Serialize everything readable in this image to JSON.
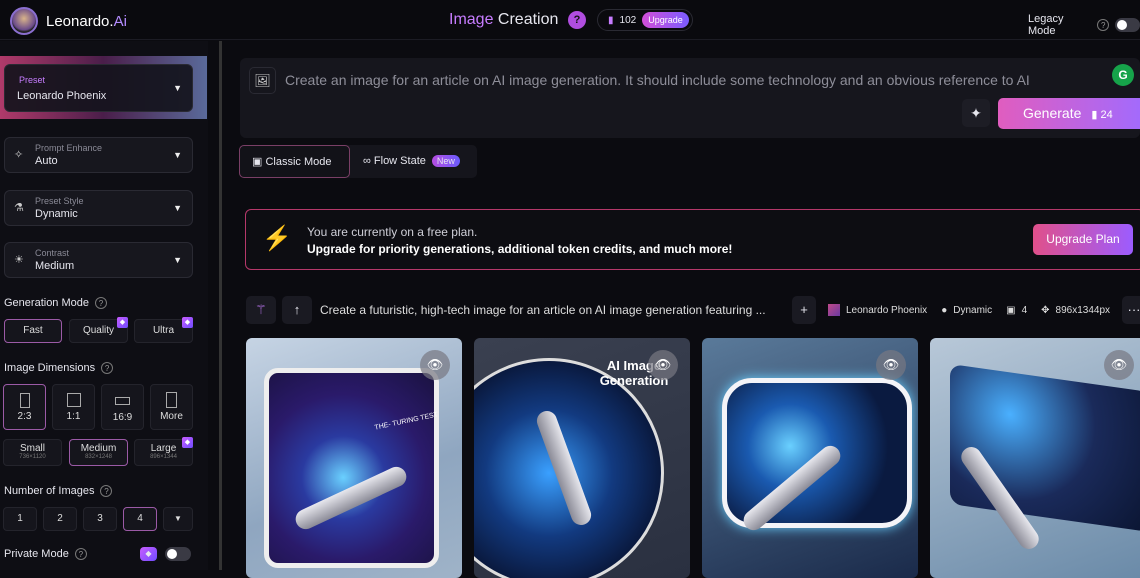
{
  "header": {
    "logo": "Leonardo.",
    "logo_ai": "Ai",
    "title_a": "Image",
    "title_b": "Creation",
    "help": "?",
    "tokens": "102",
    "upgrade": "Upgrade",
    "legacy_mode": "Legacy Mode"
  },
  "sidebar": {
    "preset": {
      "label": "Preset",
      "value": "Leonardo Phoenix"
    },
    "prompt_enhance": {
      "label": "Prompt Enhance",
      "value": "Auto"
    },
    "preset_style": {
      "label": "Preset Style",
      "value": "Dynamic"
    },
    "contrast": {
      "label": "Contrast",
      "value": "Medium"
    },
    "generation_mode": {
      "label": "Generation Mode",
      "options": [
        "Fast",
        "Quality",
        "Ultra"
      ],
      "selected": "Fast"
    },
    "image_dimensions": {
      "label": "Image Dimensions",
      "ratios": [
        "2:3",
        "1:1",
        "16:9",
        "More"
      ],
      "selected_ratio": "2:3",
      "sizes": [
        {
          "name": "Small",
          "dims": "736×1120"
        },
        {
          "name": "Medium",
          "dims": "832×1248"
        },
        {
          "name": "Large",
          "dims": "896×1344"
        }
      ],
      "selected_size": "Medium"
    },
    "number_of_images": {
      "label": "Number of Images",
      "options": [
        "1",
        "2",
        "3",
        "4"
      ],
      "selected": "4"
    },
    "private_mode": {
      "label": "Private Mode",
      "enabled": false
    }
  },
  "prompt": {
    "text": "Create an image for an article on AI image generation. It should include some technology and an obvious reference to AI",
    "generate": "Generate",
    "cost": "24"
  },
  "modes": {
    "classic": "Classic Mode",
    "flow": "Flow State",
    "new": "New"
  },
  "banner": {
    "line1": "You are currently on a free plan.",
    "line2": "Upgrade for priority generations, additional token credits, and much more!",
    "button": "Upgrade Plan"
  },
  "generation": {
    "prompt": "Create a futuristic, high-tech image for an article on AI image generation featuring ...",
    "model": "Leonardo Phoenix",
    "style": "Dynamic",
    "count": "4",
    "size": "896x1344px"
  },
  "images": [
    {
      "caption": "THE- TURING TEST"
    },
    {
      "caption": "AI Image Generation"
    },
    {
      "caption": ""
    },
    {
      "caption": ""
    }
  ]
}
